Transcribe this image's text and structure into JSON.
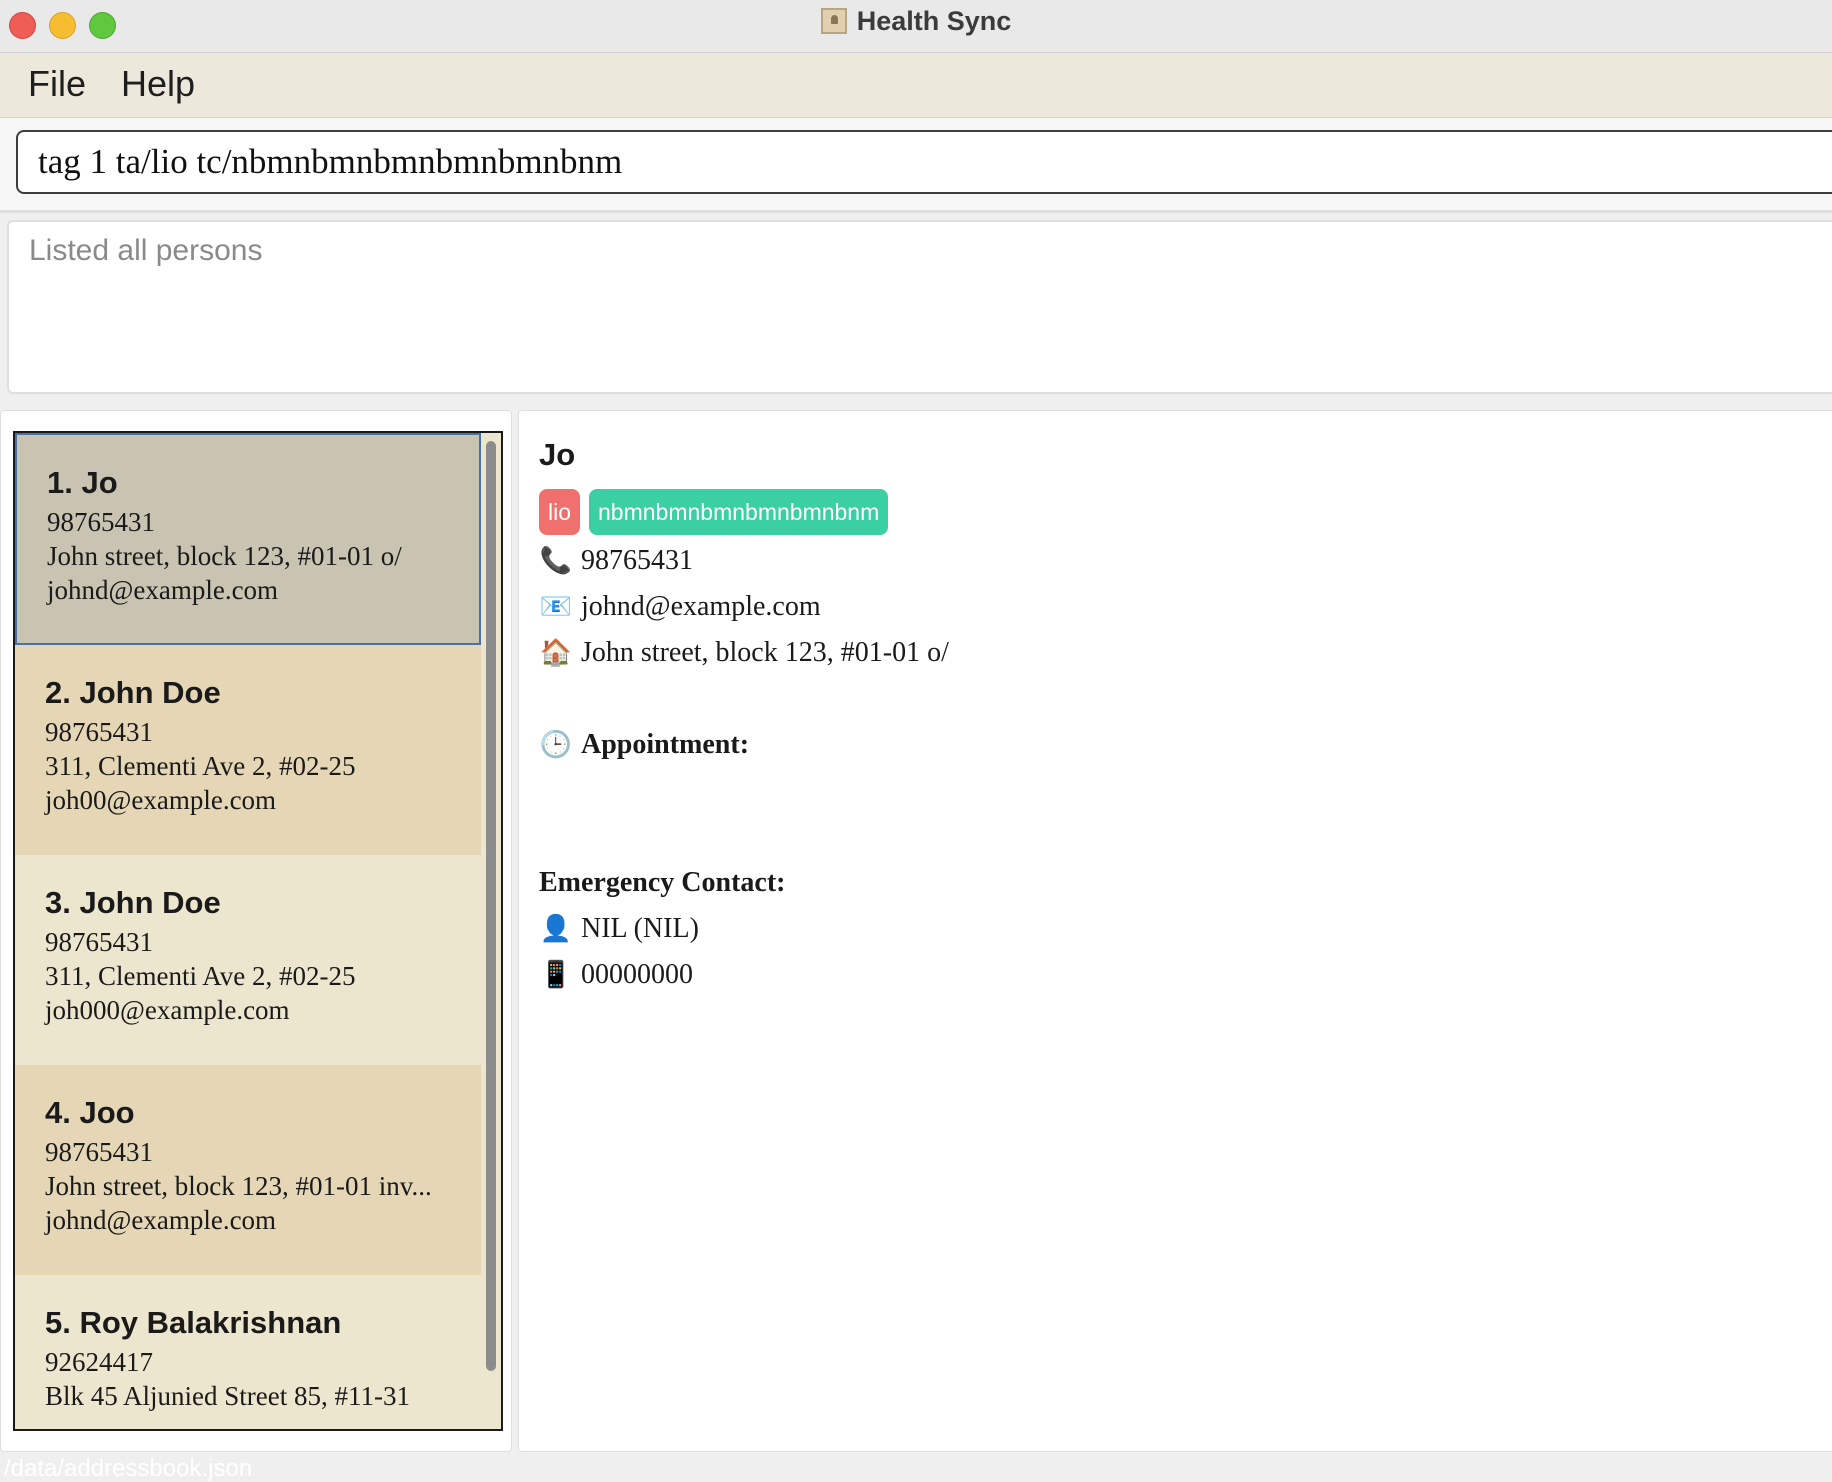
{
  "window": {
    "title": "Health Sync"
  },
  "menu": {
    "file": "File",
    "help": "Help"
  },
  "command": {
    "value": "tag 1 ta/lio tc/nbmnbmnbmnbmnbmnbnm"
  },
  "result": {
    "text": "Listed all persons"
  },
  "persons": [
    {
      "name": "1. Jo",
      "phone": "98765431",
      "address": "John street, block 123, #01-01 o/",
      "email": "johnd@example.com"
    },
    {
      "name": "2. John Doe",
      "phone": "98765431",
      "address": "311, Clementi Ave 2, #02-25",
      "email": "joh00@example.com"
    },
    {
      "name": "3. John Doe",
      "phone": "98765431",
      "address": "311, Clementi Ave 2, #02-25",
      "email": "joh000@example.com"
    },
    {
      "name": "4. Joo",
      "phone": "98765431",
      "address": "John street, block 123, #01-01 inv...",
      "email": "johnd@example.com"
    },
    {
      "name": "5. Roy Balakrishnan",
      "phone": "92624417",
      "address": "Blk 45 Aljunied Street 85, #11-31",
      "email": ""
    }
  ],
  "detail": {
    "name": "Jo",
    "tags": [
      {
        "label": "lio",
        "color": "#f0706e"
      },
      {
        "label": "nbmnbmnbmnbmnbmnbnm",
        "color": "#3bcfa4"
      }
    ],
    "phone": "98765431",
    "email": "johnd@example.com",
    "address": "John street, block 123, #01-01 o/",
    "appointment_label": "Appointment:",
    "emergency_label": "Emergency Contact:",
    "emergency_name": "NIL  (NIL)",
    "emergency_phone": "00000000",
    "icons": {
      "phone": "phone-icon",
      "email": "email-icon",
      "address": "house-icon",
      "appointment": "clock-icon",
      "emergency_name": "person-icon",
      "emergency_phone": "mobile-phone-icon"
    }
  },
  "status": {
    "path": "/data/addressbook.json"
  },
  "colors": {
    "selected_card": "#c9c3b1",
    "card_tan": "#e5d7b6",
    "card_light": "#ede6cf",
    "menu_bar": "#ece9dc"
  }
}
